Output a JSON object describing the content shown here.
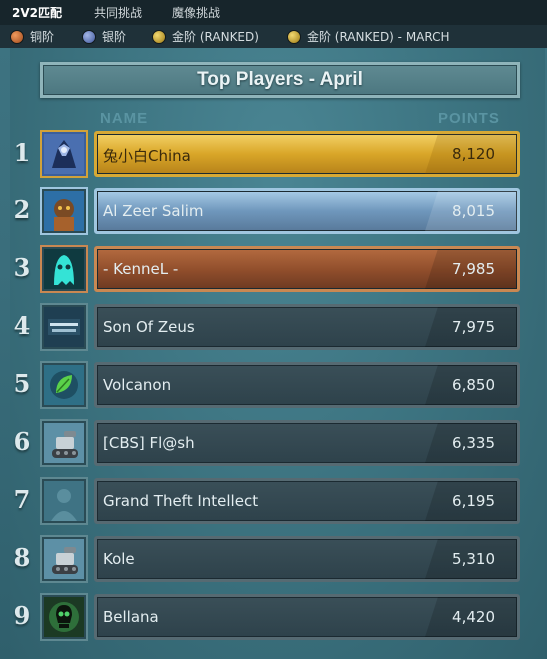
{
  "tabs": [
    {
      "label": "2V2匹配",
      "active": true
    },
    {
      "label": "共同挑战",
      "active": false
    },
    {
      "label": "魔像挑战",
      "active": false
    }
  ],
  "filters": [
    {
      "label": "铜阶",
      "color": "#c0632b"
    },
    {
      "label": "银阶",
      "color": "#5d77b8"
    },
    {
      "label": "金阶 (RANKED)",
      "color": "#c9a42a"
    },
    {
      "label": "金阶 (RANKED) - MARCH",
      "color": "#c9a42a"
    }
  ],
  "title": "Top Players - April",
  "columns": {
    "name": "NAME",
    "points": "POINTS"
  },
  "players": [
    {
      "rank": "1",
      "name": "兔小白China",
      "points": "8,120",
      "tier": "gold",
      "avatar_icon": "dragon-knight-icon"
    },
    {
      "rank": "2",
      "name": "Al Zeer Salim",
      "points": "8,015",
      "tier": "silver",
      "avatar_icon": "warrior-portrait-icon"
    },
    {
      "rank": "3",
      "name": "- KenneL -",
      "points": "7,985",
      "tier": "bronze",
      "avatar_icon": "ghost-icon"
    },
    {
      "rank": "4",
      "name": "Son Of Zeus",
      "points": "7,975",
      "tier": "",
      "avatar_icon": "rise-of-legions-logo-icon"
    },
    {
      "rank": "5",
      "name": "Volcanon",
      "points": "6,850",
      "tier": "",
      "avatar_icon": "leaf-icon"
    },
    {
      "rank": "6",
      "name": "[CBS] Fl@sh",
      "points": "6,335",
      "tier": "",
      "avatar_icon": "robot-tank-icon"
    },
    {
      "rank": "7",
      "name": "Grand Theft Intellect",
      "points": "6,195",
      "tier": "",
      "avatar_icon": "default-avatar-icon"
    },
    {
      "rank": "8",
      "name": "Kole",
      "points": "5,310",
      "tier": "",
      "avatar_icon": "robot-tank-icon"
    },
    {
      "rank": "9",
      "name": "Bellana",
      "points": "4,420",
      "tier": "",
      "avatar_icon": "skull-icon"
    }
  ]
}
